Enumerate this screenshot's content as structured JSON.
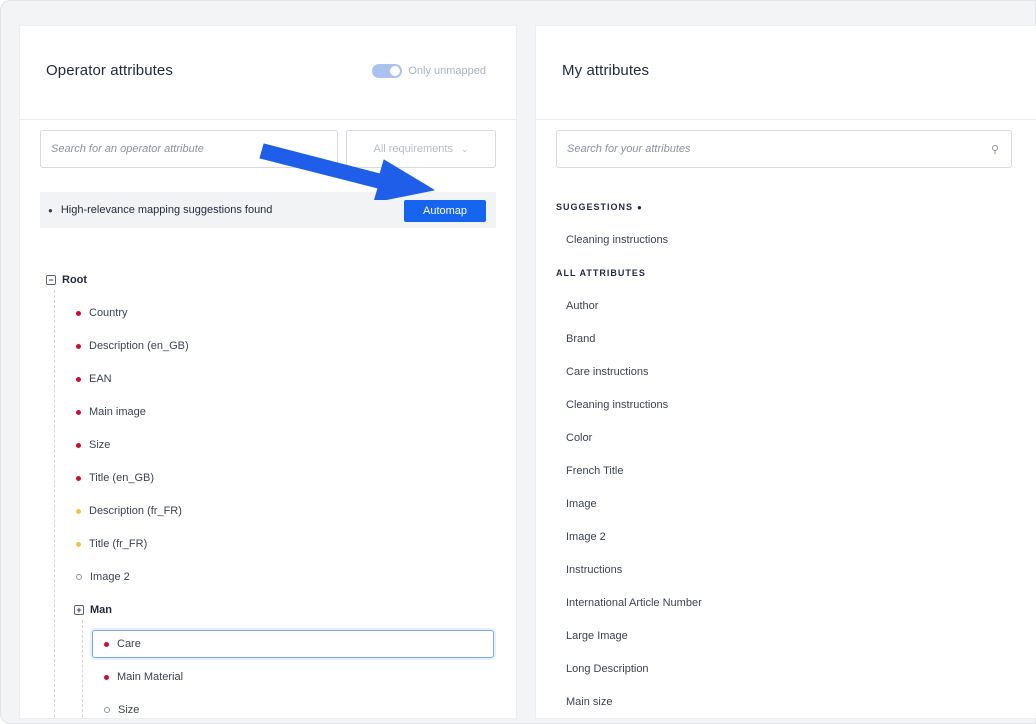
{
  "left_panel": {
    "title": "Operator attributes",
    "toggle_label": "Only unmapped",
    "search_placeholder": "Search for an operator attribute",
    "requirement_filter": "All requirements",
    "suggestion_text": "High-relevance mapping suggestions found",
    "automap_label": "Automap",
    "tree": {
      "root_label": "Root",
      "root_items": [
        {
          "label": "Country",
          "status": "required"
        },
        {
          "label": "Description (en_GB)",
          "status": "required"
        },
        {
          "label": "EAN",
          "status": "required"
        },
        {
          "label": "Main image",
          "status": "required"
        },
        {
          "label": "Size",
          "status": "required"
        },
        {
          "label": "Title (en_GB)",
          "status": "required"
        },
        {
          "label": "Description (fr_FR)",
          "status": "recommended"
        },
        {
          "label": "Title (fr_FR)",
          "status": "recommended"
        },
        {
          "label": "Image 2",
          "status": "optional"
        }
      ],
      "man_label": "Man",
      "man_items": [
        {
          "label": "Care",
          "status": "required",
          "selected": true
        },
        {
          "label": "Main Material",
          "status": "required"
        },
        {
          "label": "Size",
          "status": "optional"
        }
      ]
    }
  },
  "right_panel": {
    "title": "My attributes",
    "search_placeholder": "Search for your attributes",
    "suggestions_heading": "SUGGESTIONS",
    "suggestions": [
      "Cleaning instructions"
    ],
    "all_heading": "ALL ATTRIBUTES",
    "all_attributes": [
      "Author",
      "Brand",
      "Care instructions",
      "Cleaning instructions",
      "Color",
      "French Title",
      "Image",
      "Image 2",
      "Instructions",
      "International Article Number",
      "Large Image",
      "Long Description",
      "Main size"
    ]
  },
  "colors": {
    "accent": "#1565f0",
    "required_dot": "#c8102e",
    "recommended_dot": "#f5c04a",
    "arrow": "#1f5ee8"
  },
  "icons": {
    "brain": "brain-icon",
    "search": "search-icon",
    "collapse": "collapse-icon",
    "expand": "expand-icon"
  }
}
